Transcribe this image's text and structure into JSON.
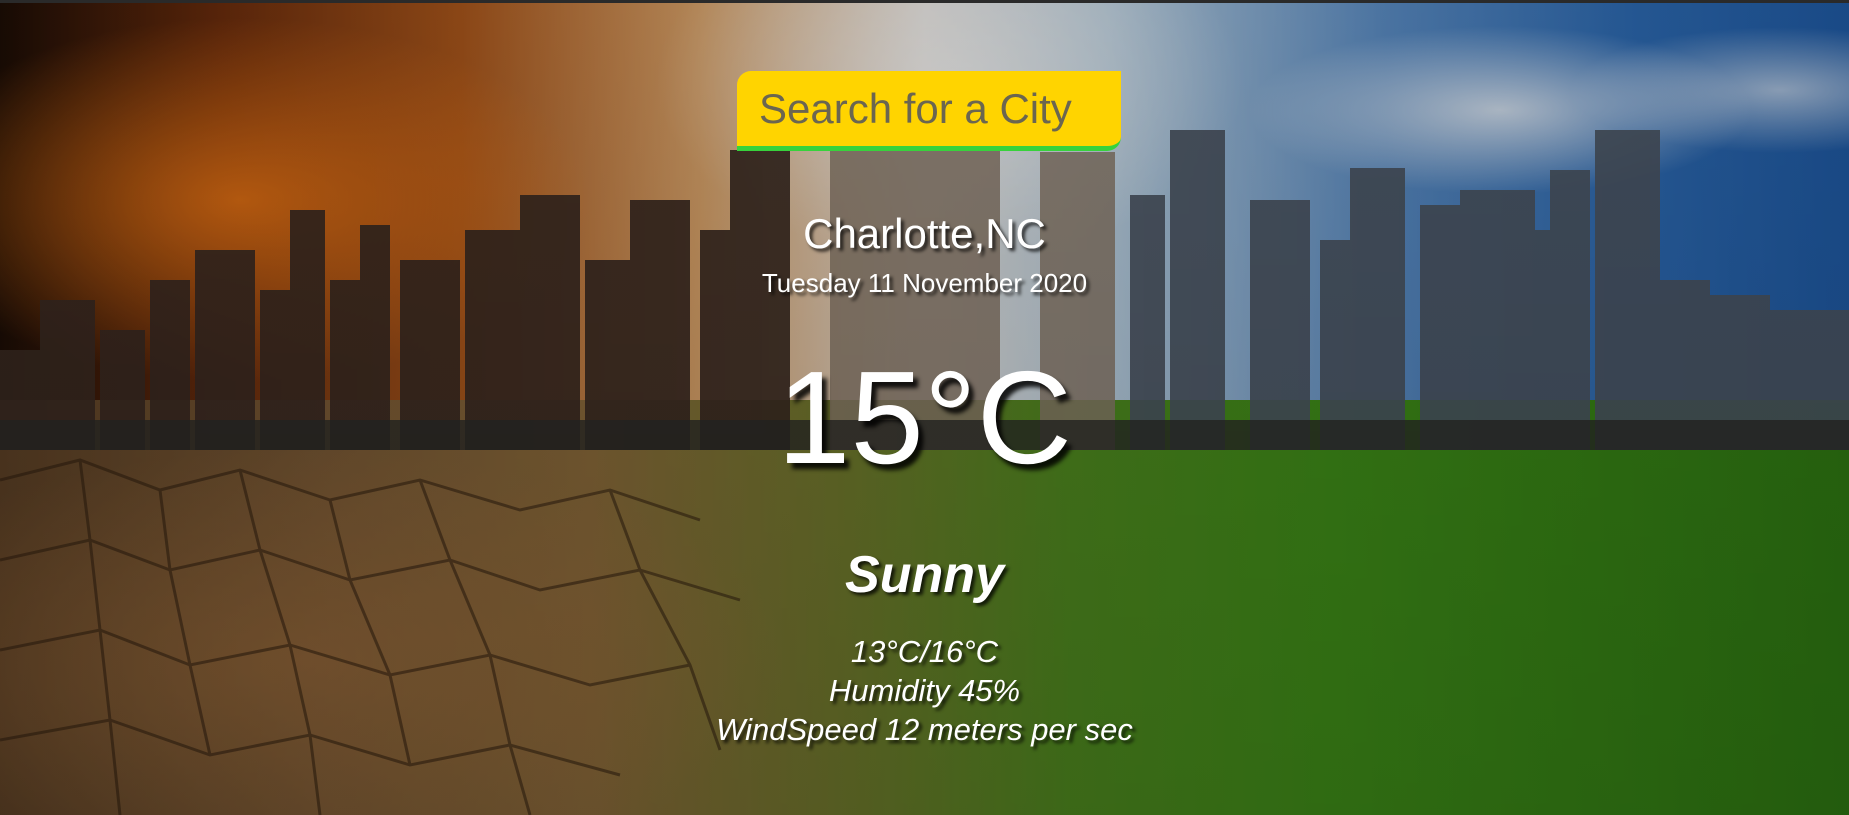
{
  "search": {
    "placeholder": "Search for a City"
  },
  "location": {
    "city": "Charlotte,NC",
    "date": "Tuesday 11 November 2020"
  },
  "weather": {
    "temperature": "15°C",
    "condition": "Sunny",
    "range": "13°C/16°C",
    "humidity": "Humidity 45%",
    "wind": "WindSpeed 12 meters per sec"
  },
  "colors": {
    "search_bg": "#ffd400",
    "search_underline": "#37d23c",
    "text": "#ffffff"
  }
}
